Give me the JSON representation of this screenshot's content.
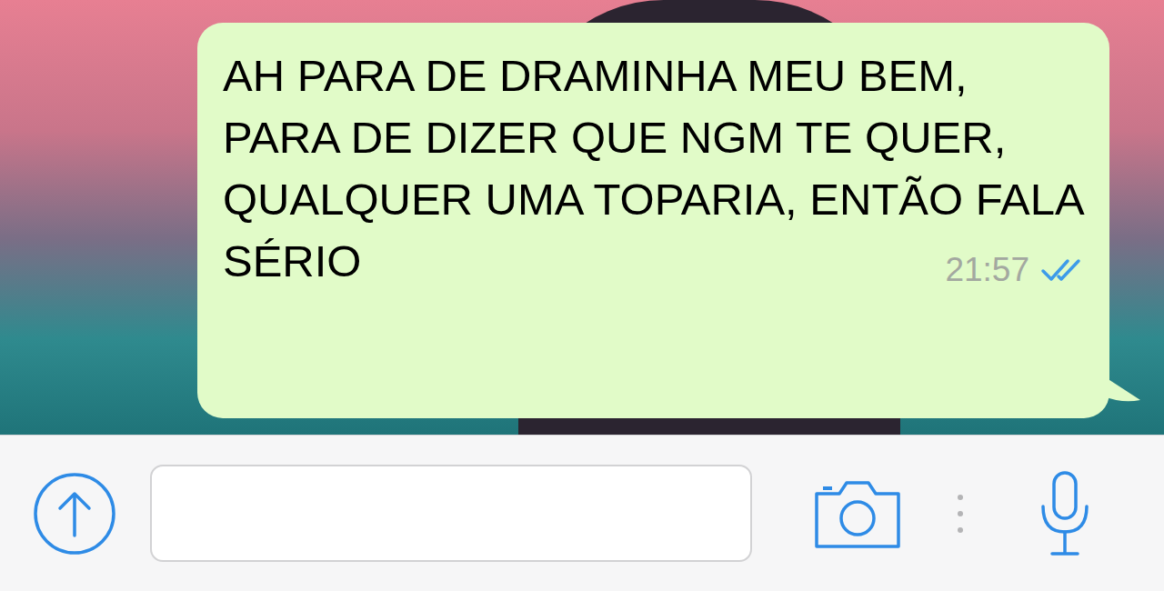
{
  "chat": {
    "messages": [
      {
        "text": "AH PARA DE DRAMINHA MEU BEM, PARA DE DIZER QUE NGM TE QUER, QUALQUER UMA TOPARIA, ENTÃO FALA SÉRIO",
        "time": "21:57",
        "outgoing": true,
        "read": true
      }
    ]
  }
}
